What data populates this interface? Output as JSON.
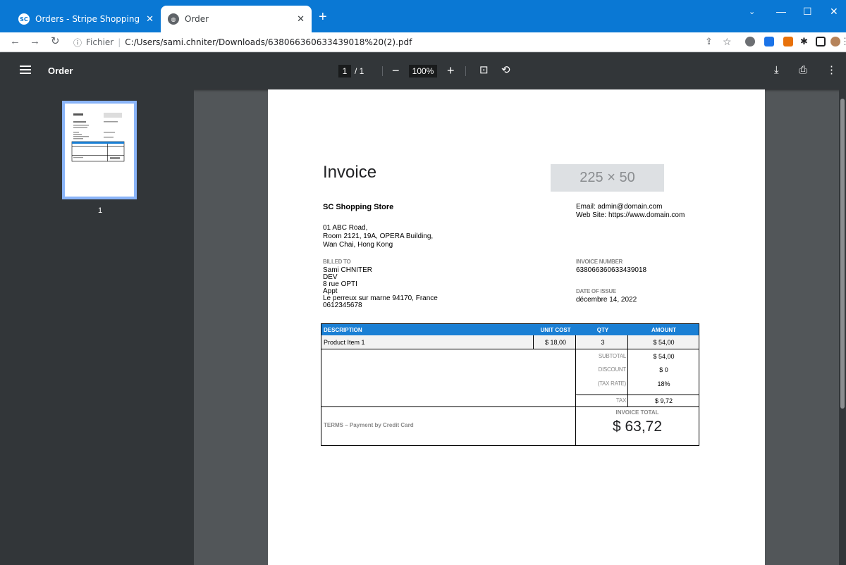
{
  "browser": {
    "tabs": [
      {
        "label": "Orders - Stripe Shopping",
        "favicon": "SC",
        "active": false
      },
      {
        "label": "Order",
        "active": true
      }
    ],
    "address": {
      "scheme_label": "Fichier",
      "url": "C:/Users/sami.chniter/Downloads/638066360633439018%20(2).pdf"
    }
  },
  "viewer": {
    "title": "Order",
    "page_current": "1",
    "page_total": "/ 1",
    "zoom": "100%",
    "thumbnail_page": "1"
  },
  "invoice": {
    "title": "Invoice",
    "logo_placeholder": "225 × 50",
    "store_name": "SC Shopping Store",
    "email": "Email: admin@domain.com",
    "website": "Web Site: https://www.domain.com",
    "address_lines": [
      "01 ABC Road,",
      "Room 2121, 19A, OPERA Building,",
      "Wan Chai, Hong Kong"
    ],
    "billed_to_label": "BILLED TO",
    "billed_to_lines": [
      "Sami CHNITER",
      "DEV",
      "8 rue OPTI",
      "Appt",
      "Le perreux sur marne 94170, France",
      "0612345678"
    ],
    "invoice_number_label": "INVOICE NUMBER",
    "invoice_number": "638066360633439018",
    "date_label": "DATE OF ISSUE",
    "date": "décembre 14, 2022",
    "table": {
      "headers": [
        "DESCRIPTION",
        "UNIT COST",
        "QTY",
        "AMOUNT"
      ],
      "rows": [
        {
          "description": "Product Item 1",
          "unit_cost": "$ 18,00",
          "qty": "3",
          "amount": "$ 54,00"
        }
      ],
      "subtotal_label": "SUBTOTAL",
      "subtotal": "$ 54,00",
      "discount_label": "DISCOUNT",
      "discount": "$ 0",
      "tax_rate_label": "(TAX RATE)",
      "tax_rate": "18%",
      "tax_label": "TAX",
      "tax": "$ 9,72",
      "terms": "TERMS – Payment by Credit Card",
      "total_label": "INVOICE TOTAL",
      "total": "$ 63,72"
    }
  }
}
